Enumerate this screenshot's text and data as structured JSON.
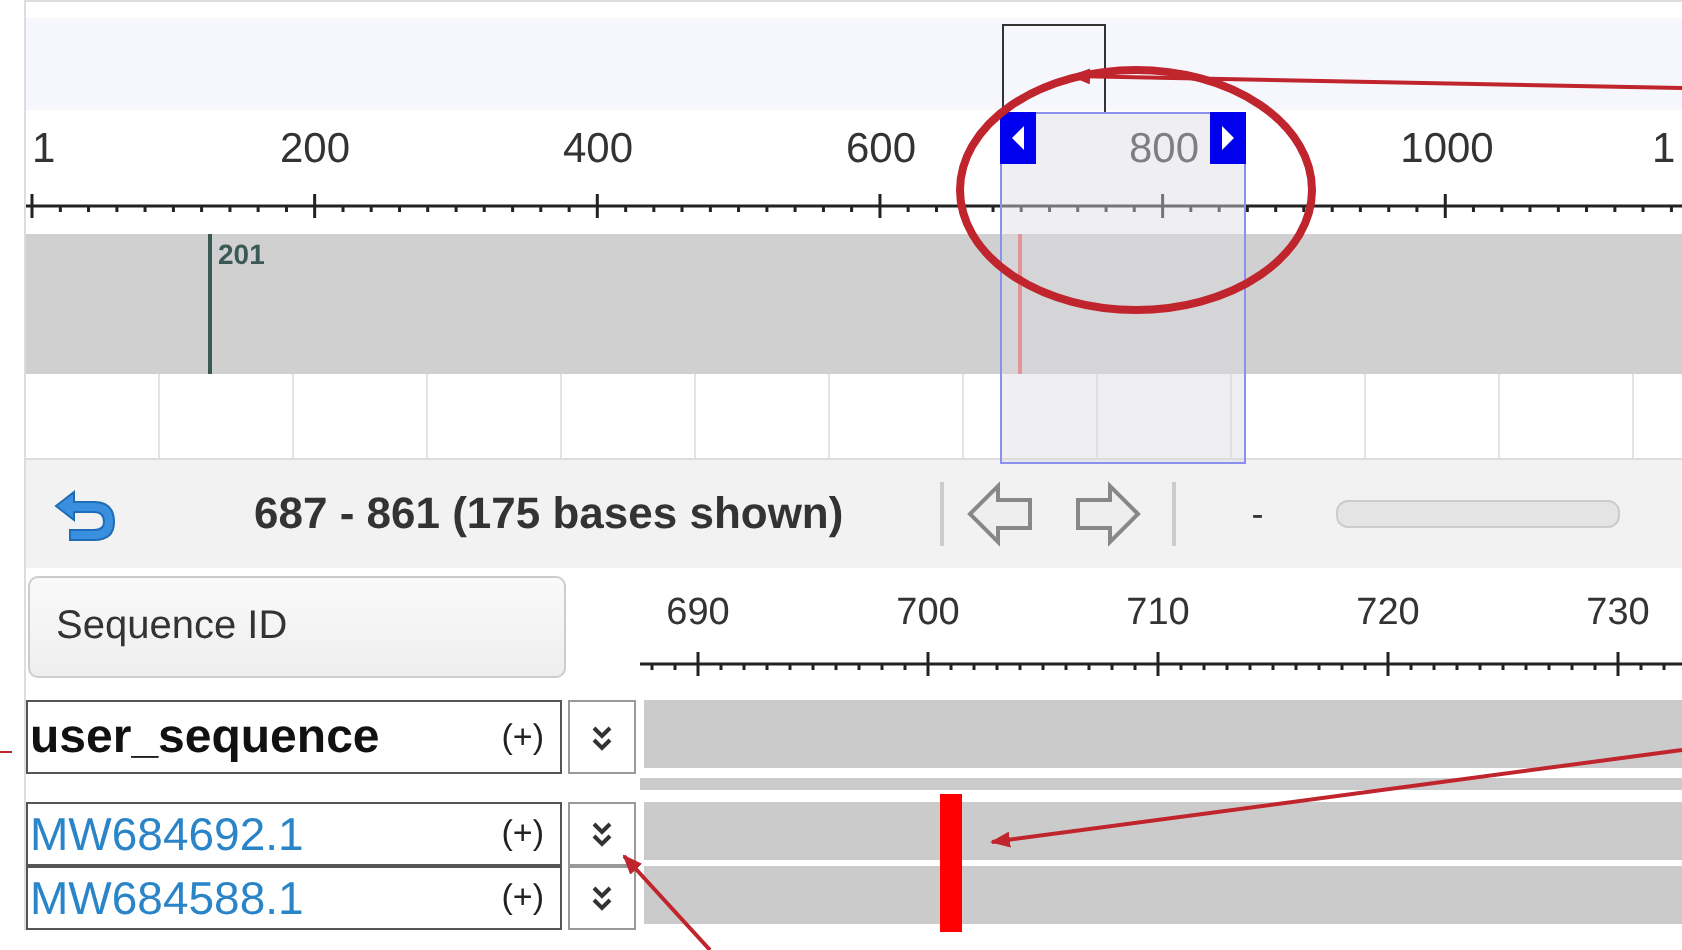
{
  "overview": {
    "ruler_labels": [
      "1",
      "200",
      "400",
      "600",
      "800",
      "1000",
      "1"
    ],
    "marker_label": "201"
  },
  "toolbar": {
    "range_text": "687 - 861 (175 bases shown)",
    "zoom_out": "-"
  },
  "alignment": {
    "header": "Sequence ID",
    "ruler_labels": [
      "690",
      "700",
      "710",
      "720",
      "730"
    ],
    "rows": [
      {
        "id": "user_sequence",
        "kind": "query",
        "toggle": "(+)"
      },
      {
        "id": "MW684692.1",
        "kind": "hit",
        "toggle": "(+)"
      },
      {
        "id": "MW684588.1",
        "kind": "hit",
        "toggle": "(+)"
      }
    ]
  }
}
